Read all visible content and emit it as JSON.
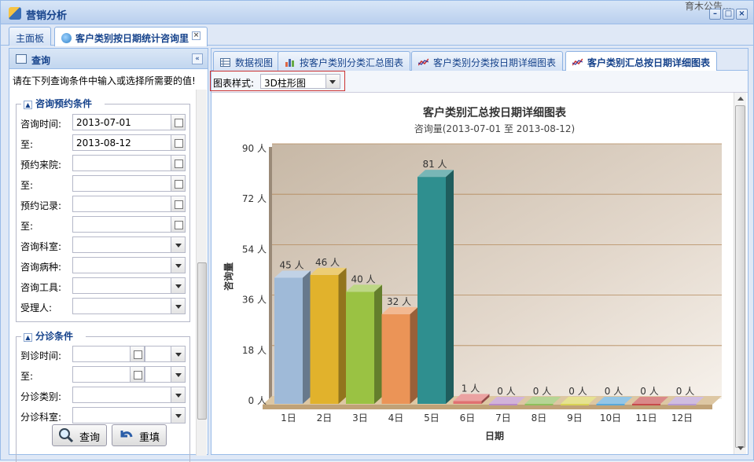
{
  "window": {
    "title": "营销分析",
    "bg_text": "育木公告..."
  },
  "tabs": [
    {
      "label": "主面板"
    },
    {
      "label": "客户类别按日期统计咨询里"
    }
  ],
  "left": {
    "title": "查询",
    "hint": "请在下列查询条件中输入或选择所需要的值!",
    "group1": {
      "legend": "咨询预约条件",
      "fields": [
        {
          "label": "咨询时间:",
          "value": "2013-07-01",
          "kind": "date"
        },
        {
          "label": "至:",
          "value": "2013-08-12",
          "kind": "date"
        },
        {
          "label": "预约来院:",
          "value": "",
          "kind": "date"
        },
        {
          "label": "至:",
          "value": "",
          "kind": "date"
        },
        {
          "label": "预约记录:",
          "value": "",
          "kind": "date"
        },
        {
          "label": "至:",
          "value": "",
          "kind": "date"
        },
        {
          "label": "咨询科室:",
          "value": "",
          "kind": "combo"
        },
        {
          "label": "咨询病种:",
          "value": "",
          "kind": "combo"
        },
        {
          "label": "咨询工具:",
          "value": "",
          "kind": "combo"
        },
        {
          "label": "受理人:",
          "value": "",
          "kind": "combo"
        }
      ]
    },
    "group2": {
      "legend": "分诊条件",
      "fields": [
        {
          "label": "到诊时间:",
          "kind": "datetime"
        },
        {
          "label": "至:",
          "kind": "datetime"
        },
        {
          "label": "分诊类别:",
          "kind": "combo"
        },
        {
          "label": "分诊科室:",
          "kind": "combo"
        }
      ]
    },
    "buttons": {
      "query": "查询",
      "reset": "重填"
    }
  },
  "right": {
    "tabs": [
      {
        "label": "数据视图"
      },
      {
        "label": "按客户类别分类汇总图表"
      },
      {
        "label": "客户类别分类按日期详细图表"
      },
      {
        "label": "客户类别汇总按日期详细图表"
      }
    ],
    "style_label": "图表样式:",
    "style_value": "3D柱形图"
  },
  "chart_data": {
    "type": "bar",
    "title": "客户类别汇总按日期详细图表",
    "subtitle": "咨询量(2013-07-01 至 2013-08-12)",
    "xlabel": "日期",
    "ylabel": "咨询量",
    "ylim": [
      0,
      90
    ],
    "yticks": [
      {
        "v": 0,
        "label": "0 人"
      },
      {
        "v": 18,
        "label": "18 人"
      },
      {
        "v": 36,
        "label": "36 人"
      },
      {
        "v": 54,
        "label": "54 人"
      },
      {
        "v": 72,
        "label": "72 人"
      },
      {
        "v": 90,
        "label": "90 人"
      }
    ],
    "categories": [
      "1日",
      "2日",
      "3日",
      "4日",
      "5日",
      "6日",
      "7日",
      "8日",
      "9日",
      "10日",
      "11日",
      "12日"
    ],
    "values": [
      45,
      46,
      40,
      32,
      81,
      1,
      0,
      0,
      0,
      0,
      0,
      0
    ],
    "value_labels": [
      "45 人",
      "46 人",
      "40 人",
      "32 人",
      "81 人",
      "1 人",
      "0 人",
      "0 人",
      "0 人",
      "0 人",
      "0 人",
      "0 人"
    ],
    "colors": [
      "#9fbad8",
      "#e1b22c",
      "#9ac243",
      "#eb9457",
      "#2f8f8f",
      "#e07070",
      "#b98ac6",
      "#8fbf5c",
      "#d8d255",
      "#5aa8d8",
      "#c64a4a",
      "#b79ad0"
    ],
    "grid": true
  }
}
